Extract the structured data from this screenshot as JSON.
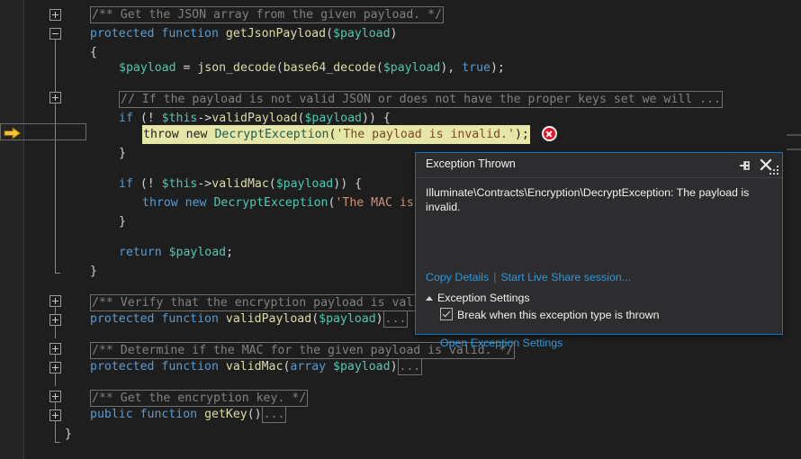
{
  "editor": {
    "execution_arrow_icon": "execution-pointer-arrow",
    "error_glyph_icon": "error-circle-icon",
    "lines": [
      {
        "n": 0,
        "text": "/** Get the JSON array from the given payload. */"
      },
      {
        "n": 1,
        "text": "protected function getJsonPayload($payload)"
      },
      {
        "n": 2,
        "text": "{"
      },
      {
        "n": 3,
        "text": ""
      },
      {
        "n": 4,
        "text": "$payload = json_decode(base64_decode($payload), true);"
      },
      {
        "n": 5,
        "text": ""
      },
      {
        "n": 6,
        "text": "// If the payload is not valid JSON or does not have the proper keys set we will ..."
      },
      {
        "n": 7,
        "text": "if (! $this->validPayload($payload)) {"
      },
      {
        "n": 8,
        "text": "throw new DecryptException('The payload is invalid.');"
      },
      {
        "n": 9,
        "text": "}"
      },
      {
        "n": 10,
        "text": ""
      },
      {
        "n": 11,
        "text": "if (! $this->validMac($payload)) {"
      },
      {
        "n": 12,
        "text": "throw new DecryptException('The MAC is"
      },
      {
        "n": 13,
        "text": "}"
      },
      {
        "n": 14,
        "text": ""
      },
      {
        "n": 15,
        "text": "return $payload;"
      },
      {
        "n": 16,
        "text": "}"
      },
      {
        "n": 17,
        "text": ""
      },
      {
        "n": 18,
        "text": "/** Verify that the encryption payload is vali"
      },
      {
        "n": 19,
        "text": "protected function validPayload($payload)..."
      },
      {
        "n": 20,
        "text": ""
      },
      {
        "n": 21,
        "text": "/** Determine if the MAC for the given payload is valid. */"
      },
      {
        "n": 22,
        "text": "protected function validMac(array $payload)..."
      },
      {
        "n": 23,
        "text": ""
      },
      {
        "n": 24,
        "text": "/** Get the encryption key. */"
      },
      {
        "n": 25,
        "text": "public function getKey()..."
      },
      {
        "n": 26,
        "text": "}"
      }
    ],
    "tokens": {
      "comment_1": "/** Get the JSON array from the given payload. */",
      "kw_protected": "protected",
      "kw_function": "function",
      "kw_public": "public",
      "kw_if": "if",
      "kw_return": "return",
      "kw_array": "array",
      "kw_true": "true",
      "fn_getJsonPayload": "getJsonPayload",
      "fn_validPayload": "validPayload",
      "fn_validMac": "validMac",
      "fn_getKey": "getKey",
      "var_payload": "$payload",
      "var_this": "$this",
      "fn_json_decode": "json_decode",
      "fn_base64_decode": "base64_decode",
      "type_DecryptException": "DecryptException",
      "kw_throw": "throw",
      "kw_new": "new",
      "str_payload_invalid": "'The payload is invalid.'",
      "str_mac_partial": "'The MAC is",
      "comment_2": "// If the payload is not valid JSON or does not have the proper keys set we will ...",
      "comment_3": "/** Verify that the encryption payload is vali",
      "comment_4": "/** Determine if the MAC for the given payload is valid. */",
      "comment_5": "/** Get the encryption key. */",
      "ellipsis": "...",
      "brace_open": "{",
      "brace_close": "}"
    },
    "colors": {
      "background": "#1e1e1e",
      "keyword": "#569cd6",
      "method": "#dcdcaa",
      "variable": "#4ec9b0",
      "string": "#ce9178",
      "comment": "#808080",
      "current_statement_bg": "#e6e6a8",
      "error_red": "#e81123",
      "arrow_yellow": "#f5c23e"
    }
  },
  "exception_dialog": {
    "title": "Exception Thrown",
    "pin_icon": "pin-icon",
    "close_icon": "close-icon",
    "message": "Illuminate\\Contracts\\Encryption\\DecryptException: The payload is invalid.",
    "copy_details_label": "Copy Details",
    "separator": "|",
    "live_share_label": "Start Live Share session...",
    "settings_section_label": "Exception Settings",
    "expander_icon": "triangle-expanded-icon",
    "checkbox_label": "Break when this exception type is thrown",
    "checkbox_checked": true,
    "open_settings_label": "Open Exception Settings",
    "resize_grip_icon": "resize-grip-icon",
    "accent_color": "#007acc",
    "link_color": "#2f97d8",
    "background": "#2d2d30"
  }
}
